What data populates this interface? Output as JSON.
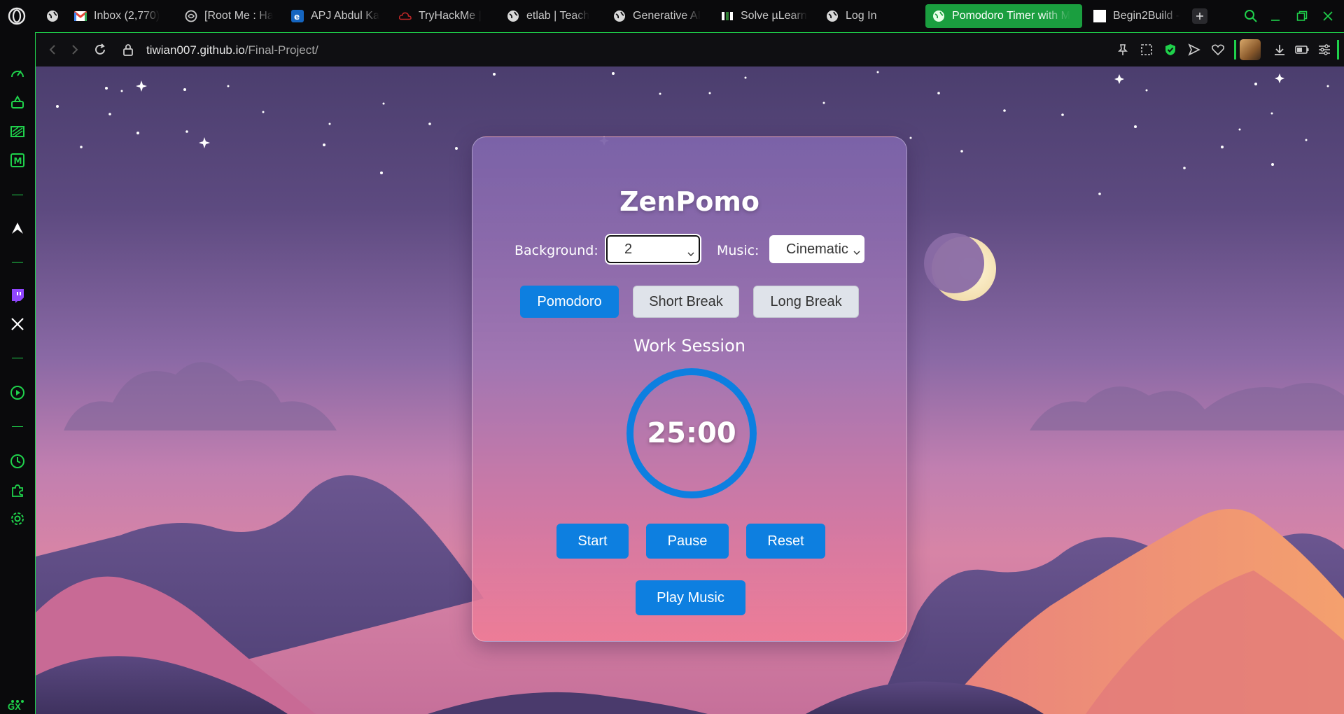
{
  "tabs": [
    {
      "label": "",
      "icon": "globe-icon"
    },
    {
      "label": "Inbox (2,770)",
      "icon": "gmail-icon"
    },
    {
      "label": "[Root Me : Ha",
      "icon": "rootme-icon"
    },
    {
      "label": "APJ Abdul Ka",
      "icon": "ktu-icon"
    },
    {
      "label": "TryHackMe |",
      "icon": "tryhackme-icon"
    },
    {
      "label": "etlab | Teach",
      "icon": "globe-icon"
    },
    {
      "label": "Generative AI",
      "icon": "globe-icon"
    },
    {
      "label": "Solve µLearn",
      "icon": "mulearn-icon"
    },
    {
      "label": "Log In",
      "icon": "globe-icon"
    },
    {
      "label": "Pomodoro Timer with M",
      "icon": "globe-icon",
      "active": true
    },
    {
      "label": "Begin2Build -",
      "icon": "page-icon"
    }
  ],
  "address": {
    "domain": "tiwian007.github.io",
    "path": "/Final-Project/"
  },
  "app": {
    "title": "ZenPomo",
    "background_label": "Background:",
    "background_value": "2",
    "music_label": "Music:",
    "music_value": "Cinematic",
    "modes": [
      "Pomodoro",
      "Short Break",
      "Long Break"
    ],
    "active_mode": "Pomodoro",
    "session_label": "Work Session",
    "timer": "25:00",
    "timer_progress": 1.0,
    "buttons": {
      "start": "Start",
      "pause": "Pause",
      "reset": "Reset",
      "play_music": "Play Music"
    }
  },
  "sidebar": {
    "gx_label": "GX",
    "items": [
      "speed-dial-icon",
      "ai-assistant-icon",
      "gx-corner-icon",
      "gx-m-icon",
      "aria-icon",
      "twitch-icon",
      "x-icon",
      "player-icon",
      "history-icon",
      "extensions-icon",
      "settings-icon"
    ]
  },
  "colors": {
    "accent": "#1fd14b",
    "button_blue": "#0d7fe0",
    "active_tab": "#1a9e3f"
  }
}
